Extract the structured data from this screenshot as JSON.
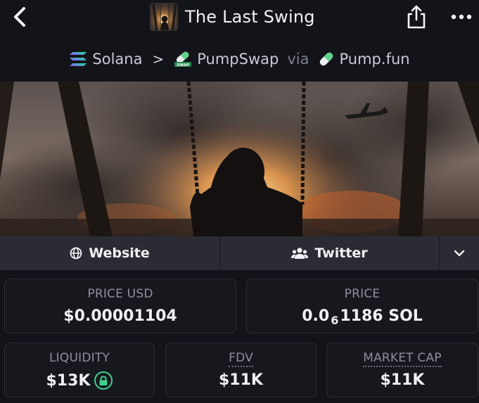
{
  "header": {
    "title": "The Last Swing",
    "back_icon": "chevron-left-icon",
    "share_icon": "share-icon",
    "more_icon": "more-horizontal-icon"
  },
  "breadcrumb": {
    "chain": "Solana",
    "separator": ">",
    "dex": "PumpSwap",
    "via": "via",
    "launchpad": "Pump.fun",
    "dex_badge": "SWAP"
  },
  "links": {
    "website": "Website",
    "twitter": "Twitter"
  },
  "stats": {
    "price_usd_label": "PRICE USD",
    "price_usd_value": "$0.00001104",
    "price_label": "PRICE",
    "price_prefix": "0.0",
    "price_sub": "6",
    "price_suffix": "1186 SOL",
    "liquidity_label": "LIQUIDITY",
    "liquidity_value": "$13K",
    "fdv_label": "FDV",
    "fdv_value": "$11K",
    "mcap_label": "MARKET CAP",
    "mcap_value": "$11K"
  },
  "colors": {
    "background": "#131419",
    "card": "#17181e",
    "link_bar": "#2a2b33",
    "lock_green": "#3fcf8e"
  }
}
